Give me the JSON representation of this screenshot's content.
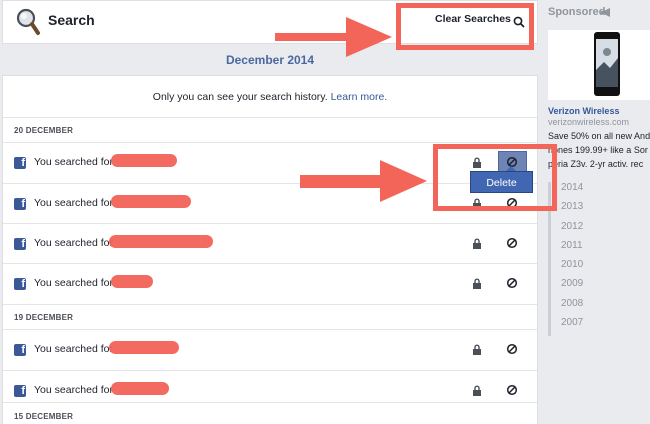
{
  "header": {
    "title": "Search",
    "clear_label": "Clear Searches"
  },
  "month": "December 2014",
  "privacy": {
    "text": "Only you can see your search history.",
    "link": "Learn more."
  },
  "groups": [
    {
      "day": "20 DECEMBER",
      "rows": [
        {
          "text": "You searched for",
          "active": false
        },
        {
          "text": "You searched for",
          "active": true
        },
        {
          "text": "You searched for",
          "active": false
        },
        {
          "text": "You searched for",
          "active": false
        }
      ]
    },
    {
      "day": "19 DECEMBER",
      "rows": [
        {
          "text": "You searched for",
          "active": false
        },
        {
          "text": "You searched for",
          "active": false
        }
      ]
    },
    {
      "day": "15 DECEMBER",
      "rows": []
    }
  ],
  "dropdown": {
    "delete_label": "Delete"
  },
  "sidebar": {
    "sponsored": "Sponsored",
    "ad": {
      "title": "Verizon Wireless",
      "url": "verizonwireless.com",
      "lines": [
        "Save 50% on all new Andr",
        "hones 199.99+ like a Sor",
        "peria Z3v. 2-yr activ. rec"
      ]
    },
    "years": [
      "2014",
      "2013",
      "2012",
      "2011",
      "2010",
      "2009",
      "2008",
      "2007"
    ]
  },
  "colors": {
    "annotation": "#f36559",
    "accent": "#4267b2"
  }
}
